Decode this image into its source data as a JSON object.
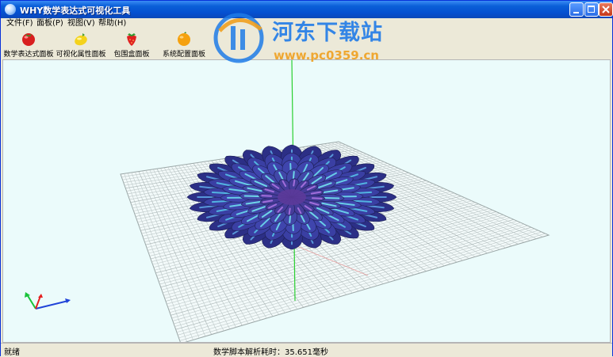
{
  "window": {
    "title": "WHY数学表达式可视化工具"
  },
  "menu": [
    "文件(F)",
    "面板(P)",
    "视图(V)",
    "帮助(H)"
  ],
  "toolbar": [
    {
      "label": "数学表达式面板",
      "icon": "tomato-icon"
    },
    {
      "label": "可视化属性面板",
      "icon": "lemon-icon"
    },
    {
      "label": "包围盒面板",
      "icon": "strawberry-icon"
    },
    {
      "label": "系统配置面板",
      "icon": "orange-icon"
    }
  ],
  "status": {
    "left": "就绪",
    "right": "数学脚本解析耗时：35.651毫秒"
  },
  "watermark": {
    "title": "河东下载站",
    "url": "www.pc0359.cn"
  },
  "colors": {
    "titlebar": "#0a5fd8",
    "viewport_bg": "#ebfbfb",
    "grid": "#b9c3c3",
    "flower": "#3b3fa8",
    "flower_highlight": "#5ee0f0",
    "y_axis": "#2ad030"
  }
}
